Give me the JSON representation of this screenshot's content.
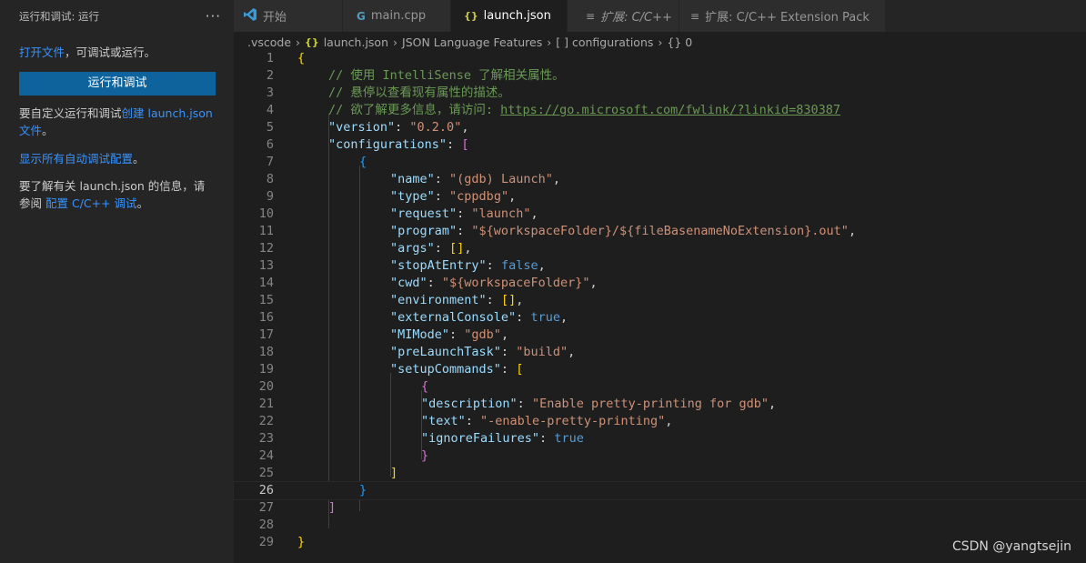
{
  "sidebar": {
    "title": "运行和调试: 运行",
    "more": "···",
    "open_file_link": "打开文件",
    "open_file_rest": "，可调试或运行。",
    "run_button": "运行和调试",
    "customize_prefix": "要自定义运行和调试",
    "create_link": "创建 launch.json",
    "file_link": "文件",
    "period": "。",
    "show_all_link": "显示所有自动调试配置",
    "info_prefix": "要了解有关 launch.json 的信息，请参阅",
    "config_link": "配置 C/C++ 调试",
    "info_suffix": "。"
  },
  "tabs": [
    {
      "icon": "vscode-icon",
      "label": "开始"
    },
    {
      "icon": "c-file-icon",
      "label": "main.cpp"
    },
    {
      "icon": "json-icon",
      "label": "launch.json"
    },
    {
      "icon": "extension-icon",
      "label": "扩展: C/C++"
    },
    {
      "icon": "extension-icon",
      "label": "扩展: C/C++ Extension Pack"
    }
  ],
  "breadcrumb": [
    ".vscode",
    "launch.json",
    "JSON Language Features",
    "configurations",
    "0"
  ],
  "breadcrumb_icons": {
    "json": "{}",
    "array": "[ ]",
    "object": "{}"
  },
  "editor": {
    "current_line": 26,
    "lines": [
      "{",
      "// 使用 IntelliSense 了解相关属性。",
      "// 悬停以查看现有属性的描述。",
      "// 欲了解更多信息，请访问: https://go.microsoft.com/fwlink/?linkid=830387",
      "\"version\": \"0.2.0\",",
      "\"configurations\": [",
      "{",
      "\"name\": \"(gdb) Launch\",",
      "\"type\": \"cppdbg\",",
      "\"request\": \"launch\",",
      "\"program\": \"${workspaceFolder}/${fileBasenameNoExtension}.out\",",
      "\"args\": [],",
      "\"stopAtEntry\": false,",
      "\"cwd\": \"${workspaceFolder}\",",
      "\"environment\": [],",
      "\"externalConsole\": true,",
      "\"MIMode\": \"gdb\",",
      "\"preLaunchTask\": \"build\",",
      "\"setupCommands\": [",
      "{",
      "\"description\": \"Enable pretty-printing for gdb\",",
      "\"text\": \"-enable-pretty-printing\",",
      "\"ignoreFailures\": true",
      "}",
      "]",
      "}",
      "]",
      "",
      "}"
    ]
  },
  "watermark": "CSDN @yangtsejin",
  "colors": {
    "accent": "#0e639c",
    "link": "#3794ff",
    "string": "#ce9178",
    "key": "#9cdcfe",
    "comment": "#6a9955"
  }
}
